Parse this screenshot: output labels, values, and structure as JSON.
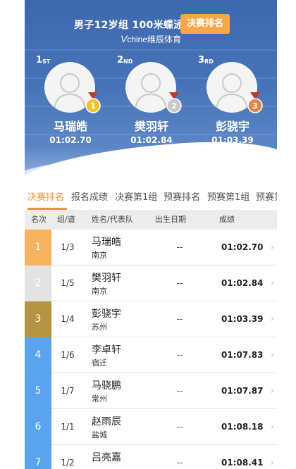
{
  "header": {
    "event_title": "男子12岁组 100米蝶泳",
    "final_rank_button": "决赛排名",
    "brand_v": "V",
    "brand_rest": "chine维辰体育"
  },
  "podium": [
    {
      "place_num": "1",
      "place_suffix": "ST",
      "name": "马瑞皓",
      "time": "01:02.70",
      "medal_label": "1",
      "medal_color": "#f0c430"
    },
    {
      "place_num": "2",
      "place_suffix": "ND",
      "name": "樊羽轩",
      "time": "01:02.84",
      "medal_label": "2",
      "medal_color": "#c9c9c9"
    },
    {
      "place_num": "3",
      "place_suffix": "RD",
      "name": "彭骁宇",
      "time": "01:03.39",
      "medal_label": "3",
      "medal_color": "#e0854e"
    }
  ],
  "tabs": [
    "决赛排名",
    "报名成绩",
    "决赛第1组",
    "预赛排名",
    "预赛第1组",
    "预赛第"
  ],
  "table": {
    "headers": {
      "rank": "名次",
      "lane": "组/道",
      "name": "姓名/代表队",
      "dob": "出生日期",
      "result": "成绩"
    },
    "rows": [
      {
        "rank": "1",
        "lane": "1/3",
        "name": "马瑞皓",
        "team": "南京",
        "dob": "--",
        "result": "01:02.70",
        "color": "#f6b25f"
      },
      {
        "rank": "2",
        "lane": "1/5",
        "name": "樊羽轩",
        "team": "南京",
        "dob": "--",
        "result": "01:02.84",
        "color": "#e3e3e3"
      },
      {
        "rank": "3",
        "lane": "1/4",
        "name": "彭骁宇",
        "team": "苏州",
        "dob": "--",
        "result": "01:03.39",
        "color": "#b39440"
      },
      {
        "rank": "4",
        "lane": "1/6",
        "name": "李卓轩",
        "team": "宿迁",
        "dob": "--",
        "result": "01:07.83",
        "color": "#5aa3ee"
      },
      {
        "rank": "5",
        "lane": "1/7",
        "name": "马骁鹏",
        "team": "常州",
        "dob": "--",
        "result": "01:07.87",
        "color": "#5aa3ee"
      },
      {
        "rank": "6",
        "lane": "1/1",
        "name": "赵雨辰",
        "team": "盐城",
        "dob": "--",
        "result": "01:08.18",
        "color": "#5aa3ee"
      },
      {
        "rank": "7",
        "lane": "1/2",
        "name": "吕亮嘉",
        "team": "",
        "dob": "--",
        "result": "01:08.41",
        "color": "#5aa3ee"
      }
    ]
  },
  "colors": {
    "accent": "#e8963a",
    "banner": "#4673b8"
  }
}
